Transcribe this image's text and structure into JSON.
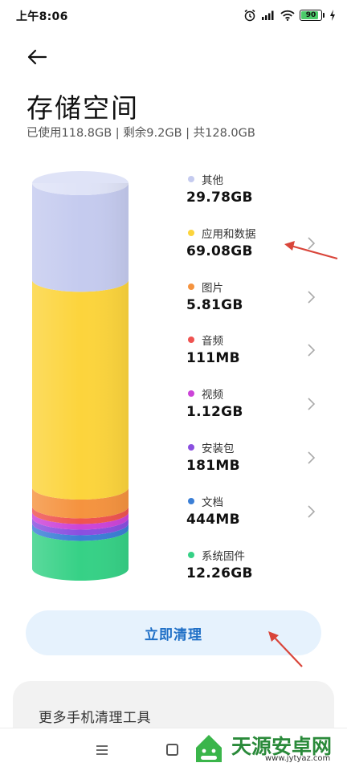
{
  "status_bar": {
    "time": "上午8:06",
    "battery": "90",
    "battery_level": 0.9,
    "icons": [
      "alarm-icon",
      "signal-icon",
      "wifi-icon",
      "battery-icon",
      "charging-icon"
    ]
  },
  "header": {
    "back_icon": "arrow-left-icon",
    "title": "存储空间",
    "summary": "已使用118.8GB | 剩余9.2GB | 共128.0GB"
  },
  "chart_data": {
    "type": "stacked-bar",
    "unit": "GB",
    "series": [
      {
        "name": "其他",
        "label": "29.78GB",
        "value": 29.78,
        "color": "#c5cbef",
        "has_chevron": false
      },
      {
        "name": "应用和数据",
        "label": "69.08GB",
        "value": 69.08,
        "color": "#fcd43c",
        "has_chevron": true
      },
      {
        "name": "图片",
        "label": "5.81GB",
        "value": 5.81,
        "color": "#f5933f",
        "has_chevron": true
      },
      {
        "name": "音频",
        "label": "111MB",
        "value": 0.111,
        "color": "#ef5350",
        "has_chevron": true
      },
      {
        "name": "视频",
        "label": "1.12GB",
        "value": 1.12,
        "color": "#cc44d8",
        "has_chevron": true
      },
      {
        "name": "安装包",
        "label": "181MB",
        "value": 0.181,
        "color": "#8a4fe0",
        "has_chevron": true
      },
      {
        "name": "文档",
        "label": "444MB",
        "value": 0.444,
        "color": "#3b7fd6",
        "has_chevron": true
      },
      {
        "name": "系统固件",
        "label": "12.26GB",
        "value": 12.26,
        "color": "#36d186",
        "has_chevron": false
      }
    ]
  },
  "actions": {
    "clean_now": "立即清理",
    "more_tools": "更多手机清理工具"
  },
  "watermark": {
    "text": "天源安卓网",
    "url": "www.jytyaz.com"
  },
  "colors": {
    "accent": "#1f6fc6",
    "button_bg": "#e6f2fd",
    "annotation_arrow": "#d9453a"
  }
}
